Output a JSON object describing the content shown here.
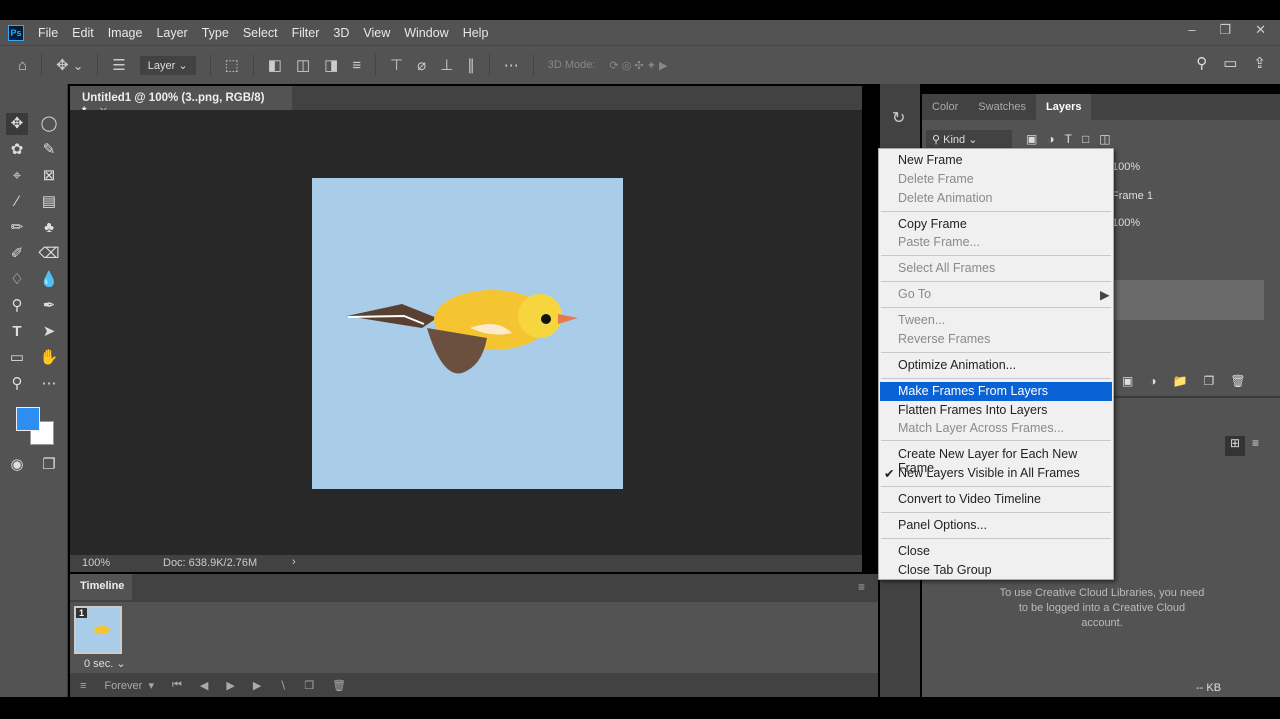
{
  "app": {
    "logo": "Ps",
    "menus": [
      "File",
      "Edit",
      "Image",
      "Layer",
      "Type",
      "Select",
      "Filter",
      "3D",
      "View",
      "Window",
      "Help"
    ]
  },
  "options": {
    "auto_select": "Layer",
    "mode_3d": "3D Mode:"
  },
  "document": {
    "tab_title": "Untitled1 @ 100% (3..png, RGB/8) *",
    "zoom": "100%",
    "doc_size": "Doc: 638.9K/2.76M"
  },
  "timeline": {
    "title": "Timeline",
    "frame_number": "1",
    "frame_delay": "0 sec.",
    "loop": "Forever"
  },
  "panels": {
    "tabs": [
      "Color",
      "Swatches",
      "Layers"
    ],
    "filter_kind": "Kind",
    "opacity": "100%",
    "fill": "100%",
    "unify_label": "Frame 1"
  },
  "libraries": {
    "message": "To use Creative Cloud Libraries, you need to be logged into a Creative Cloud account.",
    "size": "-- KB"
  },
  "context_menu": {
    "items": [
      {
        "label": "New Frame",
        "enabled": true
      },
      {
        "label": "Delete Frame",
        "enabled": false
      },
      {
        "label": "Delete Animation",
        "enabled": false
      },
      {
        "label": "Copy Frame",
        "enabled": true
      },
      {
        "label": "Paste Frame...",
        "enabled": false
      },
      {
        "label": "Select All Frames",
        "enabled": false
      },
      {
        "label": "Go To",
        "enabled": false
      },
      {
        "label": "Tween...",
        "enabled": false
      },
      {
        "label": "Reverse Frames",
        "enabled": false
      },
      {
        "label": "Optimize Animation...",
        "enabled": true
      },
      {
        "label": "Make Frames From Layers",
        "enabled": true,
        "highlighted": true
      },
      {
        "label": "Flatten Frames Into Layers",
        "enabled": true
      },
      {
        "label": "Match Layer Across Frames...",
        "enabled": false
      },
      {
        "label": "Create New Layer for Each New Frame",
        "enabled": true
      },
      {
        "label": "New Layers Visible in All Frames",
        "enabled": true,
        "checked": true
      },
      {
        "label": "Convert to Video Timeline",
        "enabled": true
      },
      {
        "label": "Panel Options...",
        "enabled": true
      },
      {
        "label": "Close",
        "enabled": true
      },
      {
        "label": "Close Tab Group",
        "enabled": true
      }
    ]
  },
  "colors": {
    "foreground": "#2e8ff0",
    "background": "#ffffff",
    "highlight": "#0a63d6",
    "canvas": "#a9cde8"
  }
}
